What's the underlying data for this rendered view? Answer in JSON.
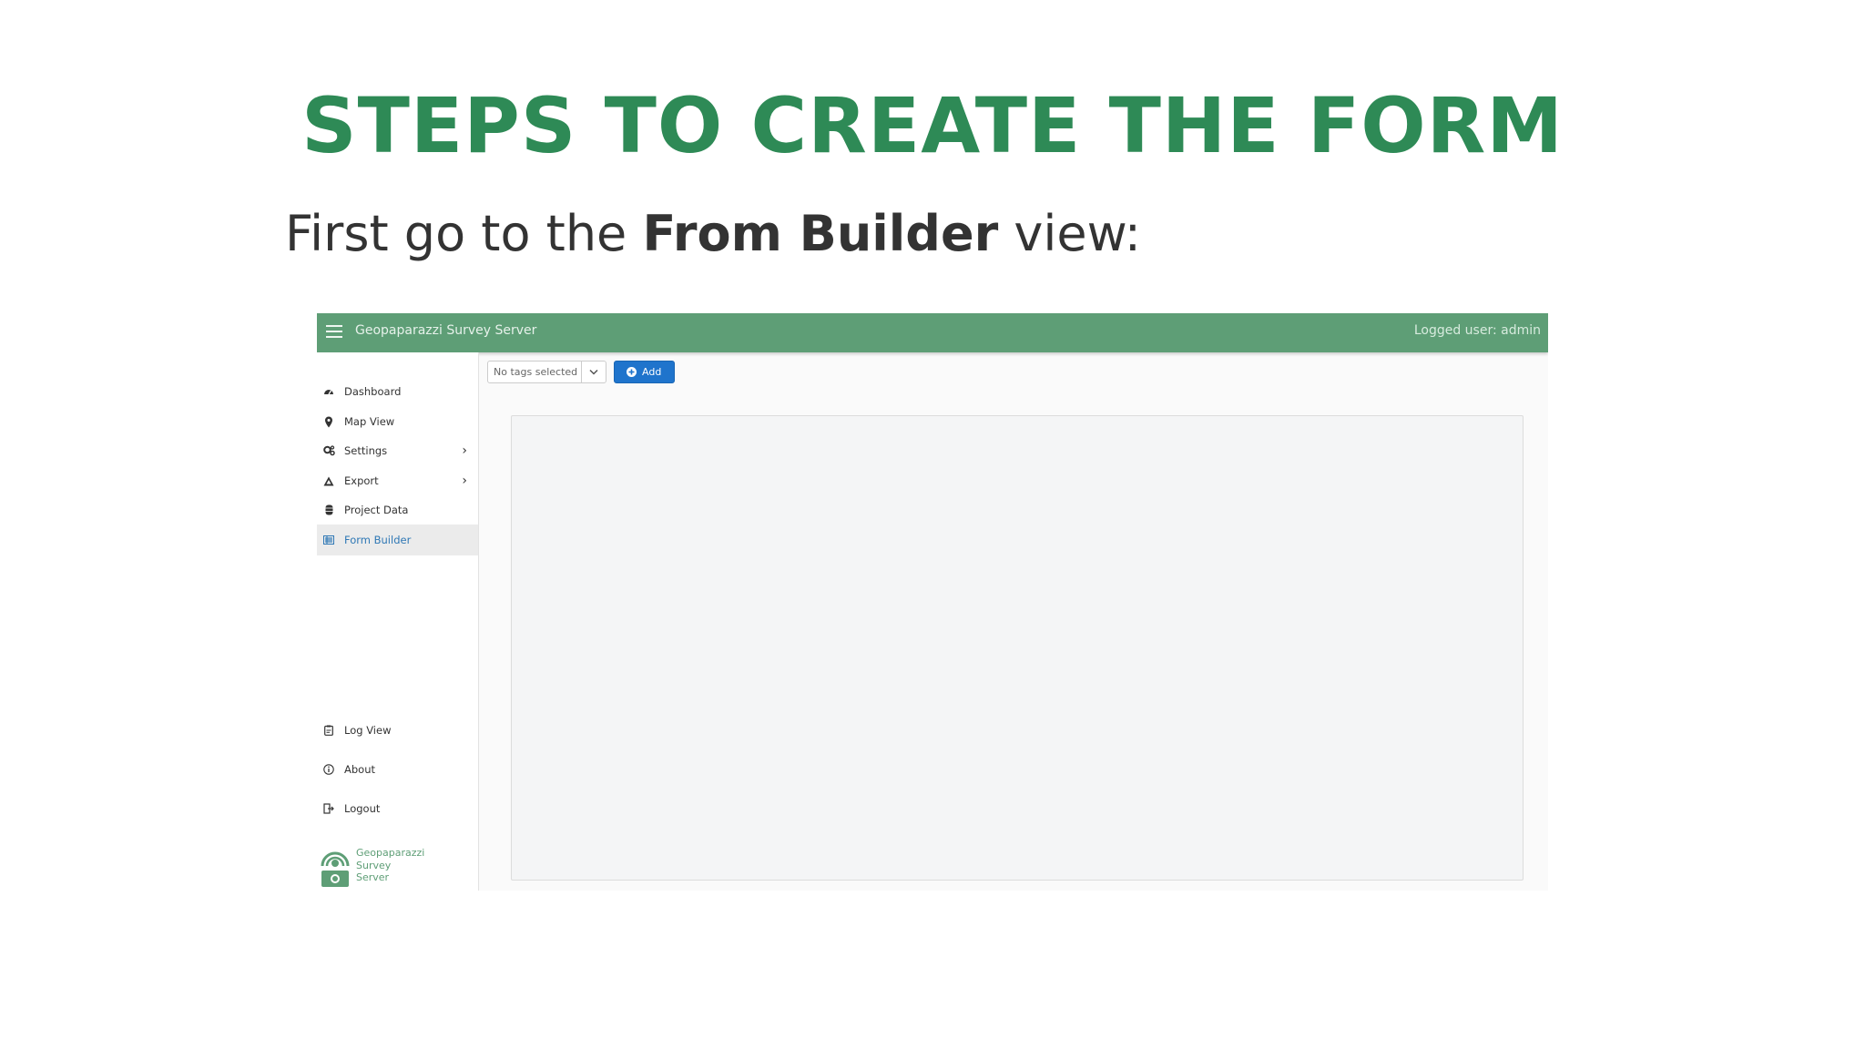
{
  "slide": {
    "title": "STEPS TO CREATE THE FORM",
    "subtitle_pre": "First go to the ",
    "subtitle_bold": "From Builder",
    "subtitle_post": " view:"
  },
  "app": {
    "title": "Geopaparazzi Survey Server",
    "logged_user": "Logged user: admin",
    "accent_color": "#5e9e76",
    "primary_color": "#1f74cc"
  },
  "sidebar": {
    "items": [
      {
        "label": "Dashboard",
        "icon": "dashboard-icon"
      },
      {
        "label": "Map View",
        "icon": "map-pin-icon"
      },
      {
        "label": "Settings",
        "icon": "gears-icon"
      },
      {
        "label": "Export",
        "icon": "export-icon"
      },
      {
        "label": "Project Data",
        "icon": "database-icon"
      },
      {
        "label": "Form Builder",
        "icon": "form-list-icon",
        "active": true
      }
    ],
    "bottom_items": [
      {
        "label": "Log View",
        "icon": "clipboard-icon"
      },
      {
        "label": "About",
        "icon": "info-icon"
      },
      {
        "label": "Logout",
        "icon": "logout-icon"
      }
    ],
    "brand": [
      "Geopaparazzi",
      "Survey",
      "Server"
    ]
  },
  "toolbar": {
    "tags_select_value": "No tags selected",
    "add_label": "Add"
  }
}
